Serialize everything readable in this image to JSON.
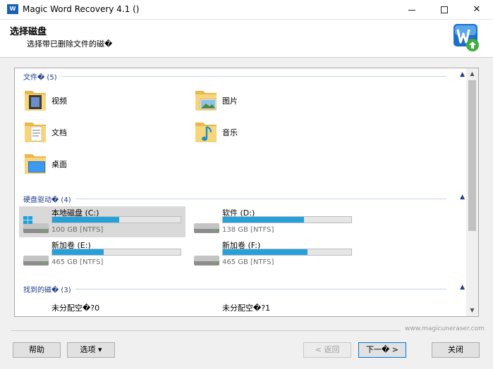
{
  "window": {
    "title": "Magic Word Recovery 4.1 ()",
    "app_icon_text": "W"
  },
  "header": {
    "title": "选择磁盘",
    "subtitle": "选择带已删除文件的磁�"
  },
  "groups": {
    "folders": {
      "label": "文件� (5)",
      "items": [
        {
          "label": "视频",
          "icon": "video-folder-icon"
        },
        {
          "label": "图片",
          "icon": "pictures-folder-icon"
        },
        {
          "label": "文档",
          "icon": "documents-folder-icon"
        },
        {
          "label": "音乐",
          "icon": "music-folder-icon"
        },
        {
          "label": "桌面",
          "icon": "desktop-folder-icon"
        }
      ]
    },
    "drives": {
      "label": "硬盘驱动� (4)",
      "items": [
        {
          "label": "本地磁盘 (C:)",
          "info": "100 GB [NTFS]",
          "used": 0.52,
          "selected": true
        },
        {
          "label": "软件 (D:)",
          "info": "138 GB [NTFS]",
          "used": 0.63,
          "selected": false
        },
        {
          "label": "新加卷 (E:)",
          "info": "465 GB [NTFS]",
          "used": 0.4,
          "selected": false
        },
        {
          "label": "新加卷 (F:)",
          "info": "465 GB [NTFS]",
          "used": 0.66,
          "selected": false
        }
      ]
    },
    "found": {
      "label": "找到的磁� (3)",
      "items": [
        {
          "label": "未分配空�?0"
        },
        {
          "label": "未分配空�?1"
        }
      ]
    }
  },
  "footer": {
    "link": "www.magicuneraser.com"
  },
  "buttons": {
    "help": "帮助",
    "options": "选项 ▾",
    "back": "< 返回",
    "next": "下一� >",
    "close": "关闭"
  },
  "colors": {
    "bar_fill": "#26a0da",
    "group_label": "#1e3c8c",
    "selected_bg": "#d9d9d9"
  }
}
